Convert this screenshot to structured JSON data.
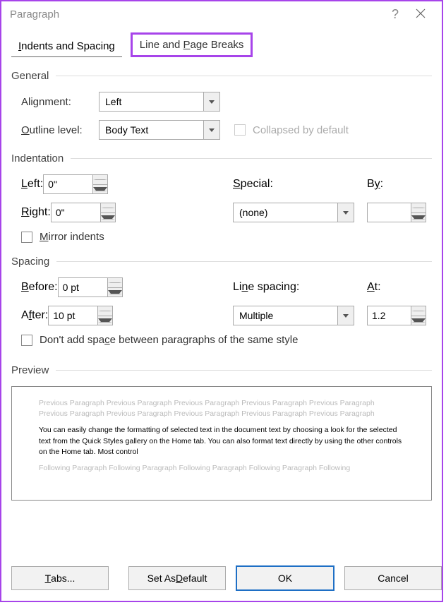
{
  "title": "Paragraph",
  "tabs": {
    "indents": "Indents and Spacing",
    "breaks": "Line and Page Breaks"
  },
  "general": {
    "header": "General",
    "alignment_label": "Alignment:",
    "alignment_value": "Left",
    "outline_label": "Outline level:",
    "outline_value": "Body Text",
    "collapsed_label": "Collapsed by default"
  },
  "indentation": {
    "header": "Indentation",
    "left_label": "Left:",
    "left_value": "0\"",
    "right_label": "Right:",
    "right_value": "0\"",
    "special_label": "Special:",
    "special_value": "(none)",
    "by_label": "By:",
    "by_value": "",
    "mirror_label": "Mirror indents"
  },
  "spacing": {
    "header": "Spacing",
    "before_label": "Before:",
    "before_value": "0 pt",
    "after_label": "After:",
    "after_value": "10 pt",
    "linespacing_label": "Line spacing:",
    "linespacing_value": "Multiple",
    "at_label": "At:",
    "at_value": "1.2",
    "noadd_label": "Don't add space between paragraphs of the same style"
  },
  "preview": {
    "header": "Preview",
    "prev_text": "Previous Paragraph Previous Paragraph Previous Paragraph Previous Paragraph Previous Paragraph Previous Paragraph Previous Paragraph Previous Paragraph Previous Paragraph Previous Paragraph",
    "sample_text": "You can easily change the formatting of selected text in the document text by choosing a look for the selected text from the Quick Styles gallery on the Home tab. You can also format text directly by using the other controls on the Home tab. Most control",
    "next_text": "Following Paragraph Following Paragraph Following Paragraph Following Paragraph Following"
  },
  "buttons": {
    "tabs": "Tabs...",
    "default": "Set As Default",
    "ok": "OK",
    "cancel": "Cancel"
  }
}
